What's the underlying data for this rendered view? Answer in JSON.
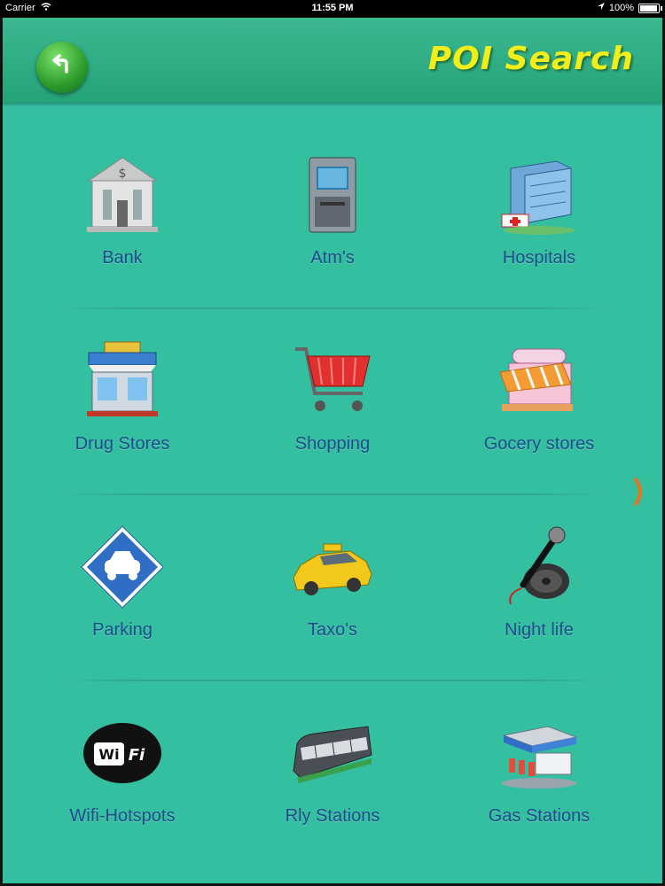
{
  "status_bar": {
    "carrier": "Carrier",
    "time": "11:55 PM",
    "battery": "100%"
  },
  "header": {
    "title": "POI Search",
    "back_icon": "back-arrow-icon"
  },
  "colors": {
    "background": "#35bfa1",
    "header": "#2aa57f",
    "title": "#f2ee1c",
    "label": "#1d4c8c",
    "accent": "#e8741a"
  },
  "categories": [
    {
      "label": "Bank",
      "icon": "bank-icon"
    },
    {
      "label": "Atm's",
      "icon": "atm-icon"
    },
    {
      "label": "Hospitals",
      "icon": "hospital-icon"
    },
    {
      "label": "Drug Stores",
      "icon": "drug-store-icon"
    },
    {
      "label": "Shopping",
      "icon": "shopping-cart-icon"
    },
    {
      "label": "Gocery stores",
      "icon": "grocery-store-icon"
    },
    {
      "label": "Parking",
      "icon": "parking-icon"
    },
    {
      "label": "Taxo's",
      "icon": "taxi-icon"
    },
    {
      "label": "Night life",
      "icon": "microphone-icon"
    },
    {
      "label": "Wifi-Hotspots",
      "icon": "wifi-icon"
    },
    {
      "label": "Rly Stations",
      "icon": "train-icon"
    },
    {
      "label": "Gas Stations",
      "icon": "gas-station-icon"
    }
  ],
  "pager": {
    "next_icon": "chevron-right-icon"
  }
}
